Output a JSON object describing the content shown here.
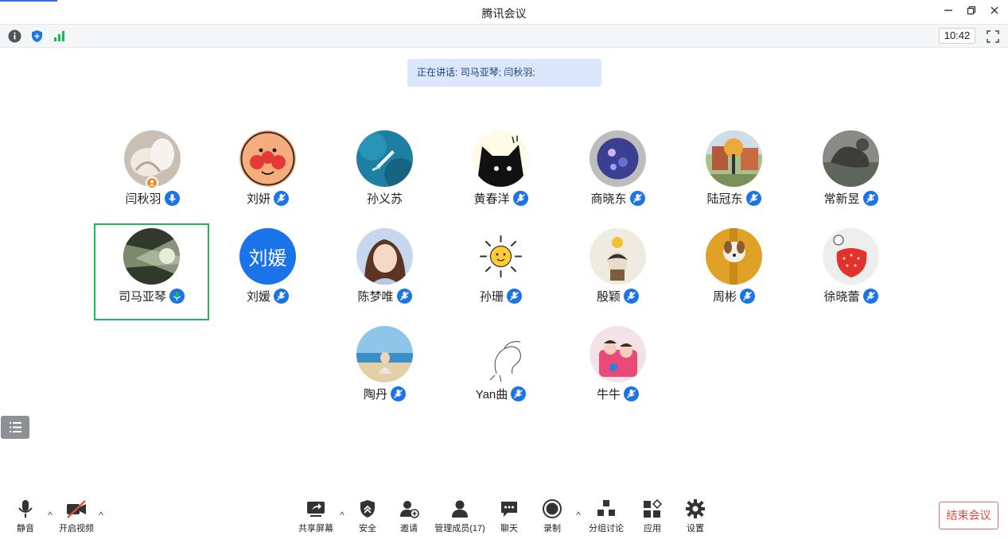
{
  "window": {
    "title": "腾讯会议"
  },
  "toolbar": {
    "clock": "10:42"
  },
  "speaking": {
    "label": "正在讲话:",
    "names": "司马亚琴; 闫秋羽;"
  },
  "participants": [
    {
      "name": "闫秋羽",
      "mic": "speaking-blue",
      "host": true
    },
    {
      "name": "刘妍",
      "mic": "muted"
    },
    {
      "name": "孙义苏",
      "mic": "none"
    },
    {
      "name": "黄春洋",
      "mic": "muted"
    },
    {
      "name": "商晓东",
      "mic": "muted"
    },
    {
      "name": "陆冠东",
      "mic": "muted"
    },
    {
      "name": "常新昱",
      "mic": "muted"
    },
    {
      "name": "司马亚琴",
      "mic": "speaking-green",
      "active": true
    },
    {
      "name": "刘媛",
      "mic": "muted",
      "avatar_text": "刘媛"
    },
    {
      "name": "陈梦唯",
      "mic": "muted"
    },
    {
      "name": "孙珊",
      "mic": "muted"
    },
    {
      "name": "殷颖",
      "mic": "muted"
    },
    {
      "name": "周彬",
      "mic": "muted"
    },
    {
      "name": "徐晓蕾",
      "mic": "muted"
    },
    {
      "name": "陶丹",
      "mic": "muted"
    },
    {
      "name": "Yan曲",
      "mic": "muted"
    },
    {
      "name": "牛牛",
      "mic": "muted"
    }
  ],
  "bottom": {
    "mute": "静音",
    "video": "开启视频",
    "share": "共享屏幕",
    "security": "安全",
    "invite": "邀请",
    "members": "管理成员(17)",
    "chat": "聊天",
    "record": "录制",
    "breakout": "分组讨论",
    "apps": "应用",
    "settings": "设置",
    "end": "结束会议"
  },
  "colors": {
    "accent": "#1a73e8",
    "active_border": "#1aba5c",
    "end": "#e44c41"
  }
}
